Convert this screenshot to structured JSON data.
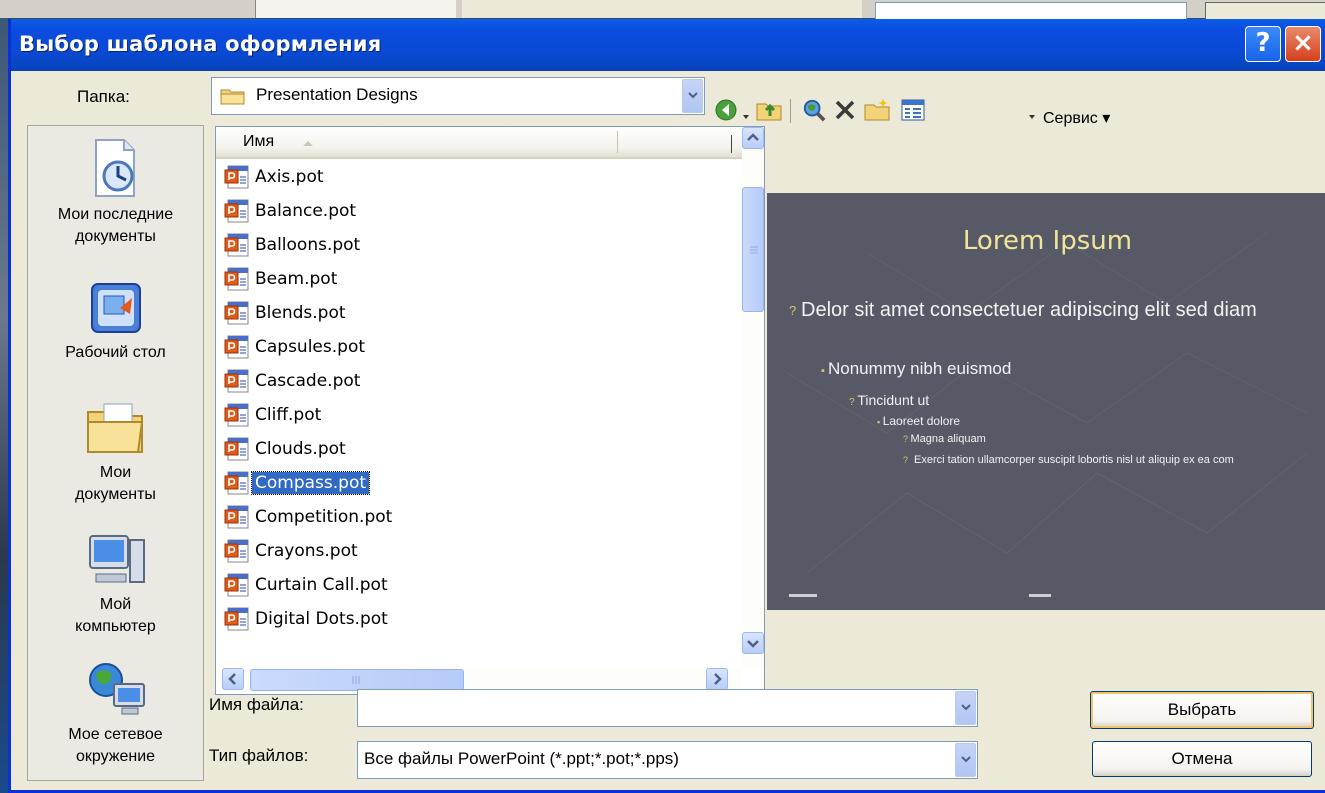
{
  "dialog": {
    "title": "Выбор шаблона оформления",
    "help_glyph": "?",
    "close_glyph": "×"
  },
  "folder": {
    "label": "Папка:",
    "value": "Presentation Designs"
  },
  "toolbar": {
    "tools_label": "Сервис",
    "tools_arrow": "▾"
  },
  "places": [
    {
      "line1": "Мои последние",
      "line2": "документы",
      "icon": "recent-documents-icon"
    },
    {
      "line1": "Рабочий стол",
      "line2": "",
      "icon": "desktop-icon"
    },
    {
      "line1": "Мои",
      "line2": "документы",
      "icon": "my-documents-icon"
    },
    {
      "line1": "Мой",
      "line2": "компьютер",
      "icon": "my-computer-icon"
    },
    {
      "line1": "Мое сетевое",
      "line2": "окружение",
      "icon": "network-icon"
    }
  ],
  "file_list": {
    "column_name": "Имя",
    "files": [
      "Axis.pot",
      "Balance.pot",
      "Balloons.pot",
      "Beam.pot",
      "Blends.pot",
      "Capsules.pot",
      "Cascade.pot",
      "Cliff.pot",
      "Clouds.pot",
      "Compass.pot",
      "Competition.pot",
      "Crayons.pot",
      "Curtain Call.pot",
      "Digital Dots.pot"
    ],
    "selected": "Compass.pot"
  },
  "preview": {
    "title": "Lorem Ipsum",
    "bullet1": "Delor sit amet consectetuer adipiscing elit sed diam",
    "bullet2": "Nonummy nibh euismod",
    "bullet3": "Tincidunt ut",
    "bullet4": "Laoreet dolore",
    "bullet5": "Magna aliquam",
    "bullet6": "Exerci tation ullamcorper suscipit lobortis nisl ut aliquip ex ea com"
  },
  "filename": {
    "label": "Имя файла:",
    "value": ""
  },
  "filetype": {
    "label": "Тип файлов:",
    "value": "Все файлы PowerPoint (*.ppt;*.pot;*.pps)"
  },
  "buttons": {
    "select": "Выбрать",
    "cancel": "Отмена"
  },
  "colors": {
    "titlebar": "#0a4ad6",
    "selection": "#316ac5",
    "preview_bg": "#575a66",
    "preview_title": "#f0e69a"
  }
}
